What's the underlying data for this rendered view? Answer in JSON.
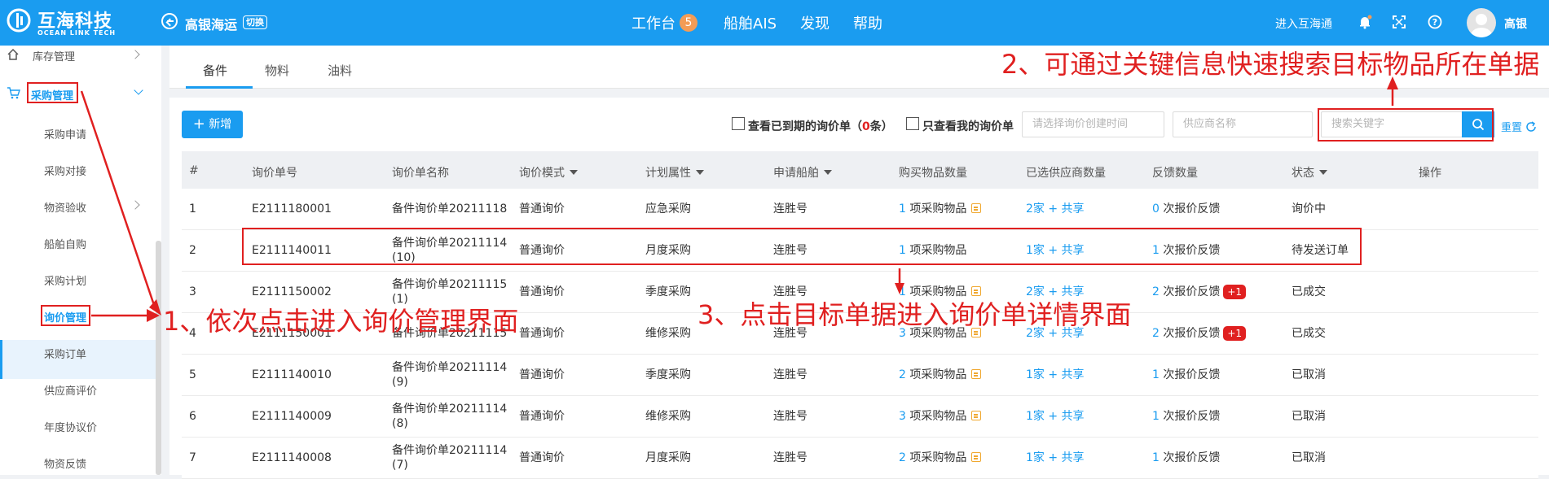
{
  "header": {
    "brand_cn": "互海科技",
    "brand_en": "OCEAN LINK TECH",
    "company": "高银海运",
    "switch_label": "切换",
    "nav": [
      {
        "label": "工作台",
        "badge": "5"
      },
      {
        "label": "船舶AIS"
      },
      {
        "label": "发现"
      },
      {
        "label": "帮助"
      }
    ],
    "enter_link": "进入互海通",
    "username": "高银",
    "accent_color": "#1a9cf0"
  },
  "sidebar": {
    "inventory": "库存管理",
    "purchase": "采购管理",
    "items": [
      "采购申请",
      "采购对接",
      "物资验收",
      "船舶自购",
      "采购计划",
      "询价管理",
      "采购订单",
      "供应商评价",
      "年度协议价",
      "物资反馈"
    ],
    "active": "询价管理"
  },
  "tabs": [
    "备件",
    "物料",
    "油料"
  ],
  "toolbar": {
    "new_button": "新增",
    "expired_prefix": "查看已到期的询价单（",
    "expired_count": "0",
    "expired_suffix": "条）",
    "mine_only": "只查看我的询价单",
    "date_placeholder": "请选择询价创建时间",
    "supplier_placeholder": "供应商名称",
    "keyword_placeholder": "搜索关键字",
    "reset": "重置"
  },
  "table": {
    "headers": [
      "#",
      "询价单号",
      "询价单名称",
      "询价模式",
      "计划属性",
      "申请船舶",
      "购买物品数量",
      "已选供应商数量",
      "反馈数量",
      "状态",
      "操作"
    ],
    "rows": [
      {
        "no": "1",
        "code": "E2111180001",
        "name1": "备件询价单20211118",
        "name2": "",
        "mode": "普通询价",
        "plan": "应急采购",
        "ship": "连胜号",
        "items_n": "1",
        "items_t": " 项采购物品",
        "sup_n": "2",
        "sup_t": "家 + 共享",
        "fb_n": "0",
        "fb_t": " 次报价反馈",
        "fb_badge": "",
        "status": "询价中"
      },
      {
        "no": "2",
        "code": "E2111140011",
        "name1": "备件询价单20211114",
        "name2": "(10)",
        "mode": "普通询价",
        "plan": "月度采购",
        "ship": "连胜号",
        "items_n": "1",
        "items_t": " 项采购物品",
        "sup_n": "1",
        "sup_t": "家 + 共享",
        "fb_n": "1",
        "fb_t": " 次报价反馈",
        "fb_badge": "",
        "status": "待发送订单"
      },
      {
        "no": "3",
        "code": "E2111150002",
        "name1": "备件询价单20211115",
        "name2": "(1)",
        "mode": "普通询价",
        "plan": "季度采购",
        "ship": "连胜号",
        "items_n": "1",
        "items_t": " 项采购物品",
        "sup_n": "2",
        "sup_t": "家 + 共享",
        "fb_n": "2",
        "fb_t": " 次报价反馈",
        "fb_badge": "+1",
        "status": "已成交"
      },
      {
        "no": "4",
        "code": "E2111150001",
        "name1": "备件询价单20211115",
        "name2": "",
        "mode": "普通询价",
        "plan": "维修采购",
        "ship": "连胜号",
        "items_n": "3",
        "items_t": " 项采购物品",
        "sup_n": "2",
        "sup_t": "家 + 共享",
        "fb_n": "2",
        "fb_t": " 次报价反馈",
        "fb_badge": "+1",
        "status": "已成交"
      },
      {
        "no": "5",
        "code": "E2111140010",
        "name1": "备件询价单20211114",
        "name2": "(9)",
        "mode": "普通询价",
        "plan": "季度采购",
        "ship": "连胜号",
        "items_n": "2",
        "items_t": " 项采购物品",
        "sup_n": "1",
        "sup_t": "家 + 共享",
        "fb_n": "1",
        "fb_t": " 次报价反馈",
        "fb_badge": "",
        "status": "已取消"
      },
      {
        "no": "6",
        "code": "E2111140009",
        "name1": "备件询价单20211114",
        "name2": "(8)",
        "mode": "普通询价",
        "plan": "维修采购",
        "ship": "连胜号",
        "items_n": "3",
        "items_t": " 项采购物品",
        "sup_n": "1",
        "sup_t": "家 + 共享",
        "fb_n": "1",
        "fb_t": " 次报价反馈",
        "fb_badge": "",
        "status": "已取消"
      },
      {
        "no": "7",
        "code": "E2111140008",
        "name1": "备件询价单20211114",
        "name2": "(7)",
        "mode": "普通询价",
        "plan": "月度采购",
        "ship": "连胜号",
        "items_n": "2",
        "items_t": " 项采购物品",
        "sup_n": "1",
        "sup_t": "家 + 共享",
        "fb_n": "1",
        "fb_t": " 次报价反馈",
        "fb_badge": "",
        "status": "已取消"
      }
    ]
  },
  "annotations": {
    "step1": "1、依次点击进入询价管理界面",
    "step2": "2、可通过关键信息快速搜索目标物品所在单据",
    "step3": "3、点击目标单据进入询价单详情界面",
    "color": "#e02020"
  }
}
